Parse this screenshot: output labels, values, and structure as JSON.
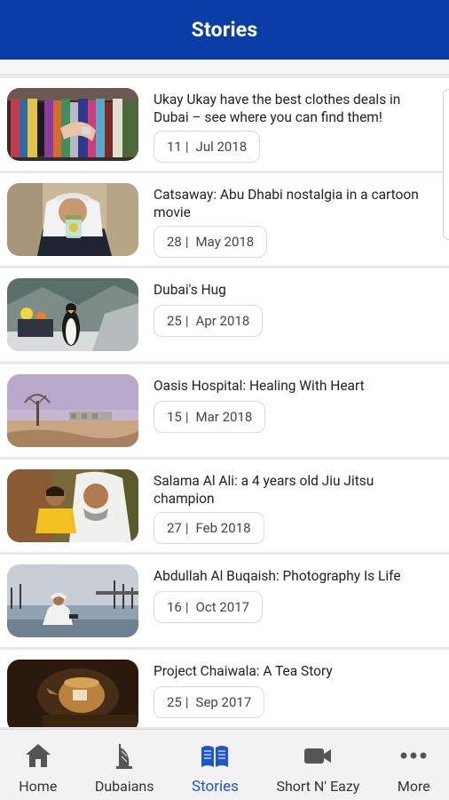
{
  "header": {
    "title": "Stories"
  },
  "stories": [
    {
      "title": "Ukay Ukay have the best clothes deals in Dubai – see where you can find them!",
      "day": "11",
      "date": "Jul 2018",
      "image": "clothes-rack-image"
    },
    {
      "title": "Catsaway: Abu Dhabi nostalgia in a cartoon movie",
      "day": "28",
      "date": "May 2018",
      "image": "man-holding-jar-image"
    },
    {
      "title": "Dubai's Hug",
      "day": "25",
      "date": "Apr 2018",
      "image": "penguin-image"
    },
    {
      "title": "Oasis Hospital: Healing With Heart",
      "day": "15",
      "date": "Mar 2018",
      "image": "desert-tree-image"
    },
    {
      "title": "Salama Al Ali: a 4 years old Jiu Jitsu champion",
      "day": "27",
      "date": "Feb 2018",
      "image": "father-child-image"
    },
    {
      "title": "Abdullah Al Buqaish: Photography Is Life",
      "day": "16",
      "date": "Oct 2017",
      "image": "man-by-water-image"
    },
    {
      "title": "Project Chaiwala: A Tea Story",
      "day": "25",
      "date": "Sep 2017",
      "image": "tea-pot-image"
    }
  ],
  "tabs": [
    {
      "label": "Home",
      "icon": "home-icon",
      "active": false
    },
    {
      "label": "Dubaians",
      "icon": "burj-al-arab-icon",
      "active": false
    },
    {
      "label": "Stories",
      "icon": "open-book-icon",
      "active": true
    },
    {
      "label": "Short N' Eazy",
      "icon": "video-camera-icon",
      "active": false
    },
    {
      "label": "More",
      "icon": "more-dots-icon",
      "active": false
    }
  ],
  "colors": {
    "header_bg": "#0a3ea6",
    "active_tab": "#1f56d0",
    "inactive_tab": "#555555"
  }
}
